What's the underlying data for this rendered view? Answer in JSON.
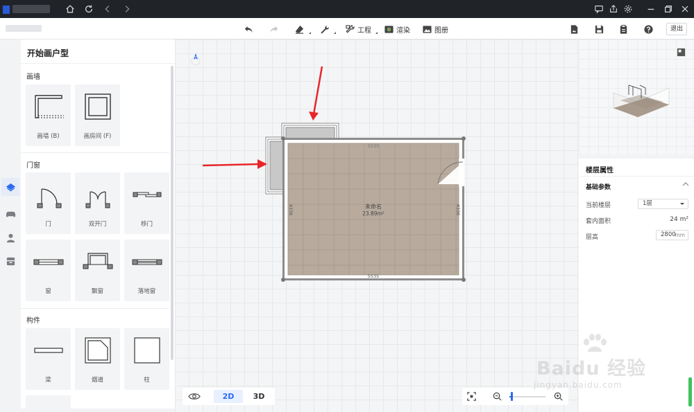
{
  "toolbar": {
    "project_label": "工程",
    "render_label": "渲染",
    "gallery_label": "图册",
    "exit_label": "退出"
  },
  "left_panel": {
    "title": "开始画户型",
    "sections": [
      {
        "title": "画墙",
        "items": [
          {
            "label": "画墙 (B)"
          },
          {
            "label": "画房间 (F)"
          }
        ]
      },
      {
        "title": "门窗",
        "items": [
          {
            "label": "门"
          },
          {
            "label": "双开门"
          },
          {
            "label": "移门"
          },
          {
            "label": "窗"
          },
          {
            "label": "飘窗"
          },
          {
            "label": "落地窗"
          }
        ]
      },
      {
        "title": "构件",
        "items": [
          {
            "label": "梁"
          },
          {
            "label": "烟道"
          },
          {
            "label": "柱"
          }
        ]
      }
    ]
  },
  "canvas": {
    "room_name": "未命名",
    "room_area": "23.89m²",
    "dim_top": "5535",
    "dim_bottom": "5535",
    "dim_left": "4336",
    "dim_right": "4336"
  },
  "view_controls": {
    "mode_2d": "2D",
    "mode_3d": "3D",
    "active_mode": "2D"
  },
  "zoom": {
    "level": 0.03
  },
  "right_panel": {
    "title": "楼层属性",
    "section_title": "基础参数",
    "current_floor_label": "当前楼层",
    "current_floor_value": "1层",
    "inner_area_label": "套内面积",
    "inner_area_value": "24 m²",
    "floor_height_label": "层高",
    "floor_height_value": "2800",
    "floor_height_unit": "mm"
  },
  "watermark": {
    "brand": "Baidu 经验",
    "url": "jingyan.baidu.com"
  },
  "colors": {
    "accent": "#2b6bf0",
    "floor": "#b8ab9e",
    "wall": "#8c8c8c",
    "arrow": "#e8262a",
    "titlebar": "#202428"
  }
}
